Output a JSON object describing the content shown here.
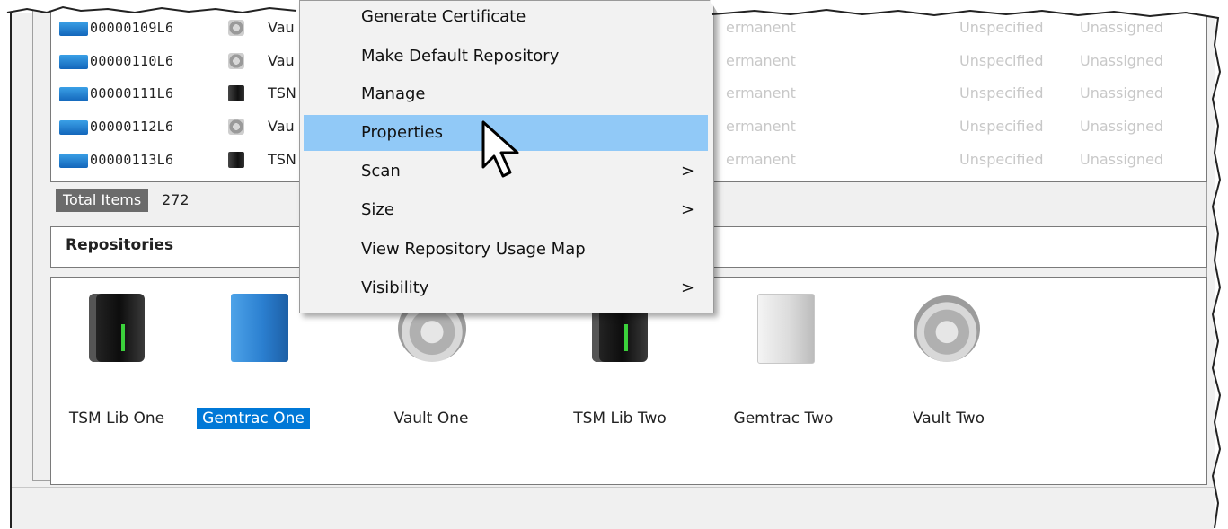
{
  "list": {
    "rows": [
      {
        "id": "00000109L6",
        "repository": "Vau",
        "repo_icon": "vault-icon",
        "retention": "ermanent",
        "location": "Unspecified",
        "owner": "Unassigned"
      },
      {
        "id": "00000110L6",
        "repository": "Vau",
        "repo_icon": "vault-icon",
        "retention": "ermanent",
        "location": "Unspecified",
        "owner": "Unassigned"
      },
      {
        "id": "00000111L6",
        "repository": "TSN",
        "repo_icon": "tsm-library-icon",
        "retention": "ermanent",
        "location": "Unspecified",
        "owner": "Unassigned"
      },
      {
        "id": "00000112L6",
        "repository": "Vau",
        "repo_icon": "vault-icon",
        "retention": "ermanent",
        "location": "Unspecified",
        "owner": "Unassigned"
      },
      {
        "id": "00000113L6",
        "repository": "TSN",
        "repo_icon": "tsm-library-icon",
        "retention": "ermanent",
        "location": "Unspecified",
        "owner": "Unassigned"
      }
    ]
  },
  "status": {
    "total_label": "Total Items",
    "total_value": "272"
  },
  "repositories": {
    "header": "Repositories",
    "items": [
      {
        "label": "TSM Lib One",
        "icon": "tsm-library-icon",
        "selected": false
      },
      {
        "label": "Gemtrac One",
        "icon": "gemtrac-blue-icon",
        "selected": true
      },
      {
        "label": "Vault One",
        "icon": "vault-icon",
        "selected": false
      },
      {
        "label": "TSM Lib Two",
        "icon": "tsm-library-icon",
        "selected": false
      },
      {
        "label": "Gemtrac Two",
        "icon": "gemtrac-white-icon",
        "selected": false
      },
      {
        "label": "Vault Two",
        "icon": "vault-icon",
        "selected": false
      }
    ]
  },
  "context_menu": {
    "items": [
      {
        "label": "Generate Certificate",
        "submenu": false,
        "hover": false
      },
      {
        "label": "Make Default Repository",
        "submenu": false,
        "hover": false
      },
      {
        "label": "Manage",
        "submenu": false,
        "hover": false
      },
      {
        "label": "Properties",
        "submenu": false,
        "hover": true
      },
      {
        "label": "Scan",
        "submenu": true,
        "hover": false
      },
      {
        "label": "Size",
        "submenu": true,
        "hover": false
      },
      {
        "label": "View Repository Usage Map",
        "submenu": false,
        "hover": false
      },
      {
        "label": "Visibility",
        "submenu": true,
        "hover": false
      }
    ],
    "submenu_glyph": ">"
  },
  "colors": {
    "selection": "#0078d7",
    "menu_hover": "#91c9f7",
    "total_label_bg": "#6b6b6b",
    "faded_text": "#c8c8c8"
  }
}
